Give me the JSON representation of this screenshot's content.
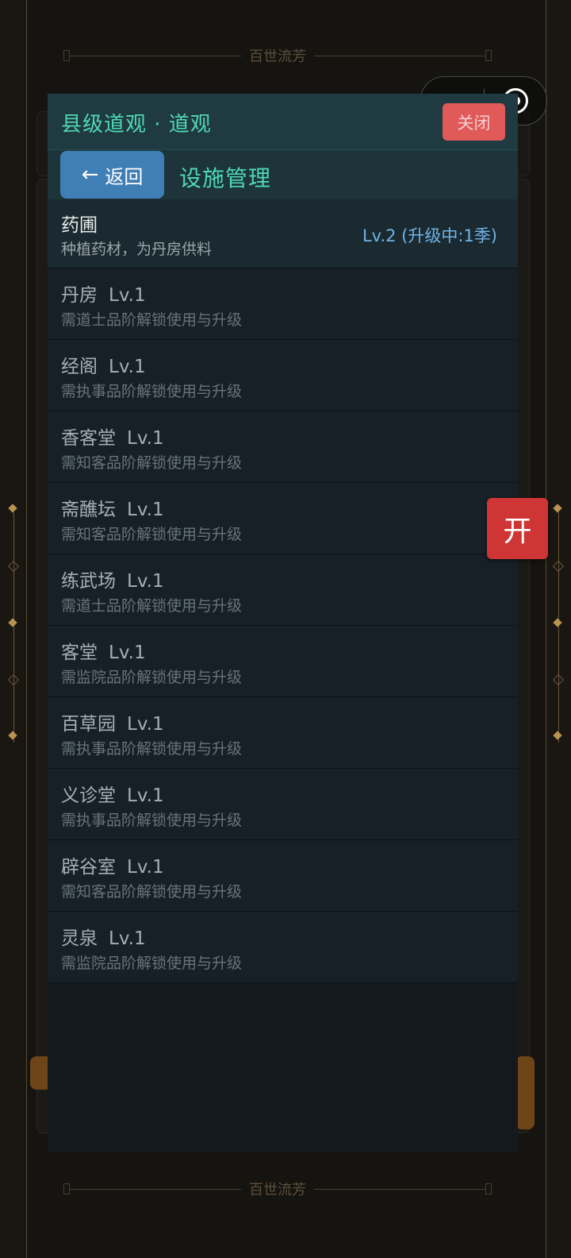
{
  "backdrop": {
    "banner_top": "百世流芳",
    "banner_bottom": "百世流芳"
  },
  "capsule": {
    "more_icon": "more-dots-icon",
    "close_icon": "target-close-icon"
  },
  "dialog": {
    "title": "县级道观 · 道观",
    "close_label": "关闭",
    "back_arrow": "←",
    "back_label": "返回",
    "subtitle": "设施管理",
    "active_facility": {
      "name": "药圃",
      "desc": "种植药材，为丹房供料",
      "status": "Lv.2 (升级中:1季)"
    },
    "facilities": [
      {
        "name": "丹房",
        "level": "Lv.1",
        "desc": "需道士品阶解锁使用与升级"
      },
      {
        "name": "经阁",
        "level": "Lv.1",
        "desc": "需执事品阶解锁使用与升级"
      },
      {
        "name": "香客堂",
        "level": "Lv.1",
        "desc": "需知客品阶解锁使用与升级"
      },
      {
        "name": "斋醮坛",
        "level": "Lv.1",
        "desc": "需知客品阶解锁使用与升级"
      },
      {
        "name": "练武场",
        "level": "Lv.1",
        "desc": "需道士品阶解锁使用与升级"
      },
      {
        "name": "客堂",
        "level": "Lv.1",
        "desc": "需监院品阶解锁使用与升级"
      },
      {
        "name": "百草园",
        "level": "Lv.1",
        "desc": "需执事品阶解锁使用与升级"
      },
      {
        "name": "义诊堂",
        "level": "Lv.1",
        "desc": "需执事品阶解锁使用与升级"
      },
      {
        "name": "辟谷室",
        "level": "Lv.1",
        "desc": "需知客品阶解锁使用与升级"
      },
      {
        "name": "灵泉",
        "level": "Lv.1",
        "desc": "需监院品阶解锁使用与升级"
      }
    ]
  },
  "float_button": {
    "label": "开"
  },
  "colors": {
    "accent": "#4fd8b4",
    "close": "#e05a5a",
    "back": "#3f7fb5",
    "status": "#6fb3e8",
    "float": "#cf3535"
  }
}
